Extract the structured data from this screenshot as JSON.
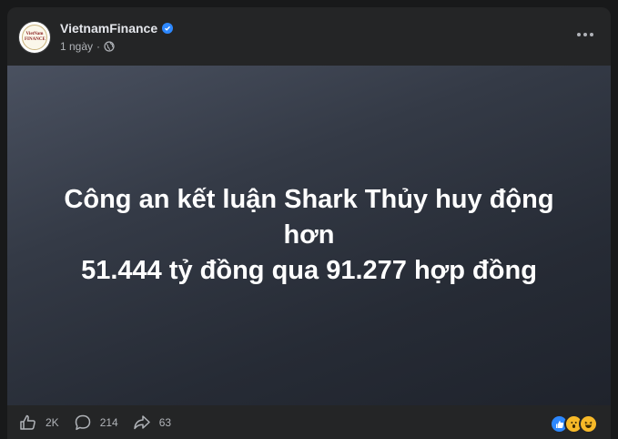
{
  "post": {
    "author": "VietnamFinance",
    "avatar_text": "VietNam FINANCE",
    "timestamp": "1 ngày",
    "separator": "·",
    "headline_line1": "Công an kết luận Shark Thủy huy động hơn",
    "headline_line2": "51.444 tỷ đồng qua 91.277 hợp đồng"
  },
  "stats": {
    "likes": "2K",
    "comments": "214",
    "shares": "63"
  },
  "icons": {
    "more": "more-options-icon",
    "verified": "verified-badge-icon",
    "privacy": "globe-icon",
    "like": "thumbs-up-icon",
    "comment": "comment-bubble-icon",
    "share": "share-arrow-icon",
    "reactions": [
      "like-reaction-icon",
      "wow-reaction-icon",
      "haha-reaction-icon"
    ]
  },
  "colors": {
    "background": "#18191a",
    "card": "#242526",
    "text_primary": "#e4e6eb",
    "text_secondary": "#b0b3b8",
    "accent": "#2d88ff"
  }
}
